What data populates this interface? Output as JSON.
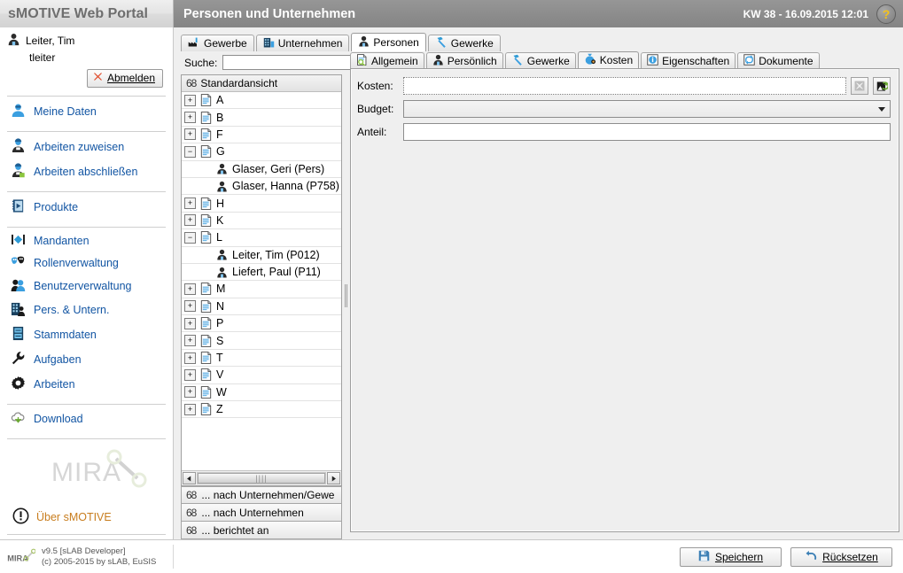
{
  "header": {
    "brand": "sMOTIVE Web Portal",
    "title": "Personen und Unternehmen",
    "clock": "KW 38 - 16.09.2015 12:01",
    "help_label": "?"
  },
  "sidebar": {
    "user": {
      "name": "Leiter, Tim",
      "login": "tleiter"
    },
    "logout_label": "Abmelden",
    "groups": [
      {
        "items": [
          {
            "label": "Meine Daten",
            "icon": "user-icon"
          }
        ]
      },
      {
        "items": [
          {
            "label": "Arbeiten zuweisen",
            "icon": "worker-assign-icon"
          },
          {
            "label": "Arbeiten abschließen",
            "icon": "worker-complete-icon"
          }
        ]
      },
      {
        "items": [
          {
            "label": "Produkte",
            "icon": "product-book-icon"
          }
        ]
      },
      {
        "items": [
          {
            "label": "Mandanten",
            "icon": "clients-icon"
          },
          {
            "label": "Rollenverwaltung",
            "icon": "roles-masks-icon"
          },
          {
            "label": "Benutzerverwaltung",
            "icon": "users-icon"
          },
          {
            "label": "Pers. & Untern.",
            "icon": "person-company-icon"
          },
          {
            "label": "Stammdaten",
            "icon": "masterdata-icon"
          },
          {
            "label": "Aufgaben",
            "icon": "wrench-icon"
          },
          {
            "label": "Arbeiten",
            "icon": "gear-icon"
          }
        ]
      },
      {
        "items": [
          {
            "label": "Download",
            "icon": "cloud-download-icon"
          }
        ]
      }
    ],
    "watermark": "MIRA",
    "about_label": "Über sMOTIVE"
  },
  "tabs": [
    {
      "label": "Gewerbe",
      "icon": "factory-icon",
      "active": false
    },
    {
      "label": "Unternehmen",
      "icon": "building-icon",
      "active": false
    },
    {
      "label": "Personen",
      "icon": "person-icon",
      "active": true
    },
    {
      "label": "Gewerke",
      "icon": "hammer-icon",
      "active": false
    }
  ],
  "tree_panel": {
    "search_label": "Suche:",
    "search_value": "",
    "search_placeholder": "",
    "view_header": "Standardansicht",
    "nodes": [
      {
        "label": "A",
        "type": "group",
        "state": "collapsed"
      },
      {
        "label": "B",
        "type": "group",
        "state": "collapsed"
      },
      {
        "label": "F",
        "type": "group",
        "state": "collapsed"
      },
      {
        "label": "G",
        "type": "group",
        "state": "expanded"
      },
      {
        "label": "Glaser, Geri (Pers)",
        "type": "person"
      },
      {
        "label": "Glaser, Hanna (P758)",
        "type": "person"
      },
      {
        "label": "H",
        "type": "group",
        "state": "collapsed"
      },
      {
        "label": "K",
        "type": "group",
        "state": "collapsed"
      },
      {
        "label": "L",
        "type": "group",
        "state": "expanded"
      },
      {
        "label": "Leiter, Tim (P012)",
        "type": "person"
      },
      {
        "label": "Liefert, Paul (P11)",
        "type": "person"
      },
      {
        "label": "M",
        "type": "group",
        "state": "collapsed"
      },
      {
        "label": "N",
        "type": "group",
        "state": "collapsed"
      },
      {
        "label": "P",
        "type": "group",
        "state": "collapsed"
      },
      {
        "label": "S",
        "type": "group",
        "state": "collapsed"
      },
      {
        "label": "T",
        "type": "group",
        "state": "collapsed"
      },
      {
        "label": "V",
        "type": "group",
        "state": "collapsed"
      },
      {
        "label": "W",
        "type": "group",
        "state": "collapsed"
      },
      {
        "label": "Z",
        "type": "group",
        "state": "collapsed"
      }
    ],
    "footer_buttons": [
      "... nach Unternehmen/Gewe",
      "... nach Unternehmen",
      "... berichtet an"
    ]
  },
  "detail": {
    "tabs": [
      {
        "label": "Allgemein",
        "icon": "document-search-icon",
        "active": false
      },
      {
        "label": "Persönlich",
        "icon": "person-icon",
        "active": false
      },
      {
        "label": "Gewerke",
        "icon": "hammer-icon",
        "active": false
      },
      {
        "label": "Kosten",
        "icon": "money-bag-icon",
        "active": true
      },
      {
        "label": "Eigenschaften",
        "icon": "info-icon",
        "active": false
      },
      {
        "label": "Dokumente",
        "icon": "documents-icon",
        "active": false
      }
    ],
    "fields": [
      {
        "label": "Kosten:",
        "value": "",
        "type": "text-with-buttons"
      },
      {
        "label": "Budget:",
        "value": "",
        "type": "select"
      },
      {
        "label": "Anteil:",
        "value": "",
        "type": "text"
      }
    ],
    "clear_button": "clear-icon",
    "pick_button": "pick-icon"
  },
  "footer": {
    "version": "v9.5 [sLAB Developer]",
    "copyright": "(c) 2005-2015 by sLAB, EuSIS",
    "logo": "MIRA",
    "save_label": "Speichern",
    "reset_label": "Rücksetzen"
  },
  "colors": {
    "link": "#1255a3",
    "accent": "#2e9bd6",
    "title_bar": "#8c8c8c",
    "about": "#c87d1e",
    "help_glyph": "#f5c21a"
  }
}
